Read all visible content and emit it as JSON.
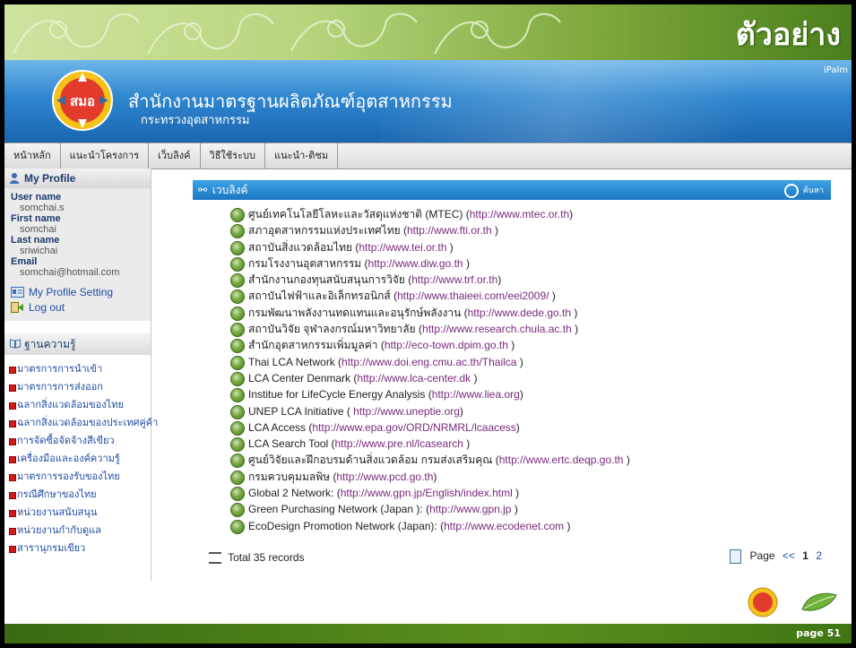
{
  "slide": {
    "sample_label": "ตัวอย่าง",
    "page_label": "page 51"
  },
  "header": {
    "org_name": "สำนักงานมาตรฐานผลิตภัณฑ์อุตสาหกรรม",
    "org_sub": "กระทรวงอุตสาหกรรม",
    "logo_text": "สมอ",
    "corner_text": "iPalm"
  },
  "nav": {
    "items": [
      {
        "label": "หน้าหลัก"
      },
      {
        "label": "แนะนำโครงการ"
      },
      {
        "label": "เว็บลิงค์"
      },
      {
        "label": "วิธีใช้ระบบ"
      },
      {
        "label": "แนะนำ-ติชม"
      }
    ]
  },
  "profile": {
    "title": "My Profile",
    "user_name_label": "User name",
    "user_name": "somchai.s",
    "first_name_label": "First name",
    "first_name": "somchai",
    "last_name_label": "Last name",
    "last_name": "sriwichai",
    "email_label": "Email",
    "email": "somchai@hotmail.com",
    "setting_link": "My Profile Setting",
    "logout_link": "Log out"
  },
  "knowledge": {
    "title": "ฐานความรู้",
    "items": [
      {
        "label": "มาตรการการนำเข้า"
      },
      {
        "label": "มาตรการการส่งออก"
      },
      {
        "label": "ฉลากสิ่งแวดล้อมของไทย"
      },
      {
        "label": "ฉลากสิ่งแวดล้อมของประเทศคู่ค้า"
      },
      {
        "label": "การจัดซื้อจัดจ้างสีเขียว"
      },
      {
        "label": "เครื่องมือและองค์ความรู้"
      },
      {
        "label": "มาตรการรองรับของไทย"
      },
      {
        "label": "กรณีศึกษาของไทย"
      },
      {
        "label": "หน่วยงานสนับสนุน"
      },
      {
        "label": "หน่วยงานกำกับดูแล"
      },
      {
        "label": "สารานุกรมเขียว"
      }
    ]
  },
  "weblinks": {
    "title": "เวบลิงค์",
    "search_label": "ค้นหา",
    "items": [
      {
        "name": "ศูนย์เทคโนโลยีโลหะและวัสดุแห่งชาติ (MTEC) (",
        "url": "http://www.mtec.or.th",
        "tail": ")"
      },
      {
        "name": "สภาอุตสาหกรรมแห่งประเทศไทย (",
        "url": "http://www.fti.or.th",
        "tail": " )"
      },
      {
        "name": "สถาบันสิ่งแวดล้อมไทย (",
        "url": "http://www.tei.or.th",
        "tail": " )"
      },
      {
        "name": "กรมโรงงานอุตสาหกรรม (",
        "url": "http://www.diw.go.th",
        "tail": " )"
      },
      {
        "name": "สำนักงานกองทุนสนับสนุนการวิจัย (",
        "url": "http://www.trf.or.th",
        "tail": ")"
      },
      {
        "name": "สถาบันไฟฟ้าและอิเล็กทรอนิกส์ (",
        "url": "http://www.thaieei.com/eei2009/",
        "tail": " )"
      },
      {
        "name": "กรมพัฒนาพลังงานทดแทนและอนุรักษ์พลังงาน (",
        "url": "http://www.dede.go.th",
        "tail": " )"
      },
      {
        "name": "สถาบันวิจัย จุฬาลงกรณ์มหาวิทยาลัย (",
        "url": "http://www.research.chula.ac.th",
        "tail": " )"
      },
      {
        "name": "สำนักอุตสาหกรรมเพิ่มมูลค่า (",
        "url": "http://eco-town.dpim.go.th",
        "tail": " )"
      },
      {
        "name": "Thai LCA Network (",
        "url": "http://www.doi.eng.cmu.ac.th/Thailca",
        "tail": " )"
      },
      {
        "name": "LCA Center Denmark (",
        "url": "http://www.lca-center.dk",
        "tail": " )"
      },
      {
        "name": "Institue for LifeCycle Energy Analysis (",
        "url": "http://www.liea.org",
        "tail": ")"
      },
      {
        "name": "UNEP LCA Initiative ( ",
        "url": "http://www.uneptie.org",
        "tail": ")"
      },
      {
        "name": "LCA Access (",
        "url": "http://www.epa.gov/ORD/NRMRL/lcaacess",
        "tail": ")"
      },
      {
        "name": "LCA Search Tool (",
        "url": "http://www.pre.nl/lcasearch",
        "tail": " )"
      },
      {
        "name": "ศูนย์วิจัยและฝึกอบรมด้านสิ่งแวดล้อม กรมส่งเสริมคุณ (",
        "url": "http://www.ertc.deqp.go.th",
        "tail": " )"
      },
      {
        "name": "กรมควบคุมมลพิษ (",
        "url": "http://www.pcd.go.th",
        "tail": ")"
      },
      {
        "name": "Global 2 Network: (",
        "url": "http://www.gpn.jp/English/index.html",
        "tail": " )"
      },
      {
        "name": "Green Purchasing Network (Japan ): (",
        "url": "http://www.gpn.jp",
        "tail": " )"
      },
      {
        "name": "EcoDesign Promotion Network (Japan): (",
        "url": "http://www.ecodenet.com",
        "tail": " )"
      }
    ],
    "total_label": "Total 35 records",
    "page_word": "Page",
    "prev": "<<",
    "pages": [
      "1",
      "2"
    ]
  },
  "colors": {
    "header_blue": "#2f86cf",
    "panel_blue": "#1c76c3",
    "banner_green": "#7da83c",
    "footer_green": "#3a6a12",
    "link_purple": "#7a2a7e",
    "link_blue": "#1f4ca3"
  }
}
